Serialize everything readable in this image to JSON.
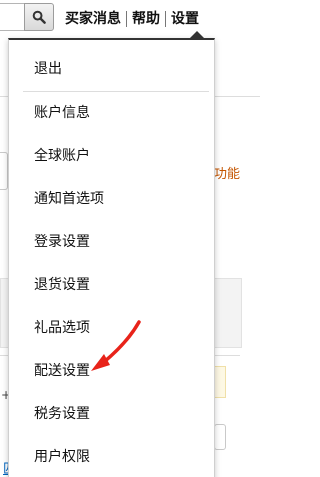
{
  "header": {
    "search_icon": "search-icon",
    "links": [
      "买家消息",
      "帮助",
      "设置"
    ]
  },
  "background": {
    "orange_text": "功能",
    "plus_text": "+ 配",
    "dollar_text": "$",
    "link_text": "匹配"
  },
  "menu": {
    "items": [
      "退出",
      "账户信息",
      "全球账户",
      "通知首选项",
      "登录设置",
      "退货设置",
      "礼品选项",
      "配送设置",
      "税务设置",
      "用户权限"
    ]
  },
  "annotation": {
    "arrow_color": "#e8231a",
    "arrow_target": "配送设置"
  }
}
